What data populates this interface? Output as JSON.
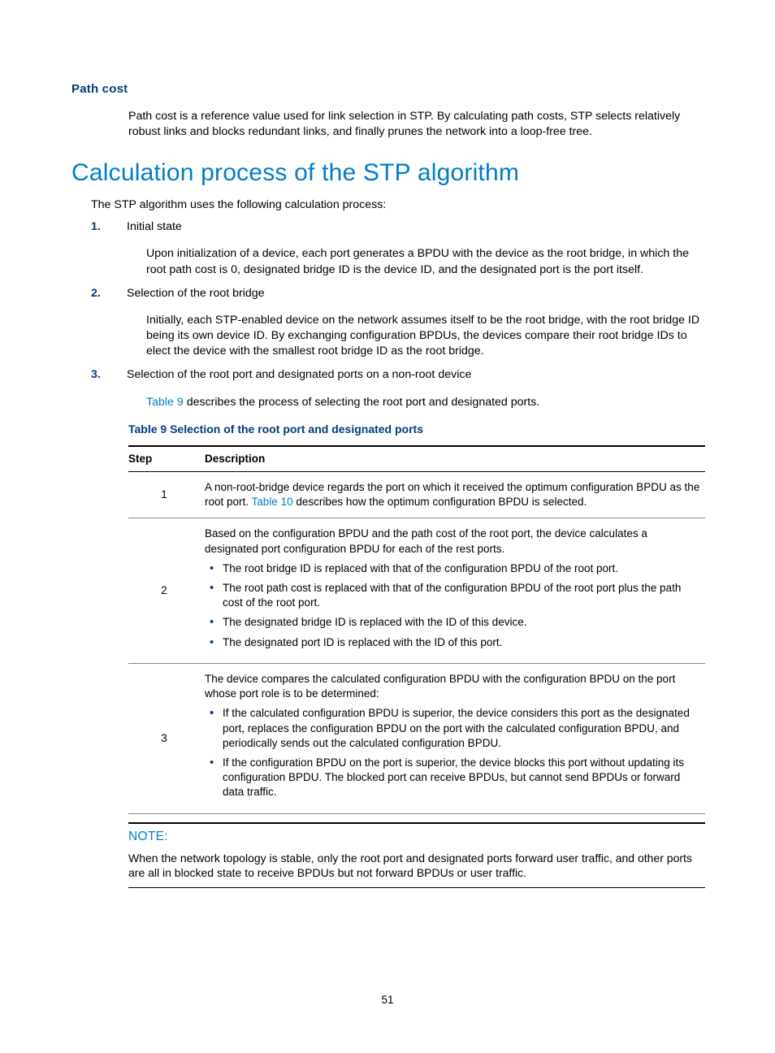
{
  "path_cost": {
    "heading": "Path cost",
    "body": "Path cost is a reference value used for link selection in STP. By calculating path costs, STP selects relatively robust links and blocks redundant links, and finally prunes the network into a loop-free tree."
  },
  "calc": {
    "heading": "Calculation process of the STP algorithm",
    "intro": "The STP algorithm uses the following calculation process:",
    "items": [
      {
        "num": "1.",
        "title": "Initial state",
        "detail": "Upon initialization of a device, each port generates a BPDU with the device as the root bridge, in which the root path cost is 0, designated bridge ID is the device ID, and the designated port is the port itself."
      },
      {
        "num": "2.",
        "title": "Selection of the root bridge",
        "detail": "Initially, each STP-enabled device on the network assumes itself to be the root bridge, with the root bridge ID being its own device ID. By exchanging configuration BPDUs, the devices compare their root bridge IDs to elect the device with the smallest root bridge ID as the root bridge."
      },
      {
        "num": "3.",
        "title": "Selection of the root port and designated ports on a non-root device",
        "detail_link": "Table 9",
        "detail_after": " describes the process of selecting the root port and designated ports."
      }
    ]
  },
  "table9": {
    "caption": "Table 9 Selection of the root port and designated ports",
    "headers": {
      "step": "Step",
      "desc": "Description"
    },
    "rows": [
      {
        "step": "1",
        "lead_before": "A non-root-bridge device regards the port on which it received the optimum configuration BPDU as the root port. ",
        "link": "Table 10",
        "lead_after": " describes how the optimum configuration BPDU is selected."
      },
      {
        "step": "2",
        "lead": "Based on the configuration BPDU and the path cost of the root port, the device calculates a designated port configuration BPDU for each of the rest ports.",
        "bullets": [
          "The root bridge ID is replaced with that of the configuration BPDU of the root port.",
          "The root path cost is replaced with that of the configuration BPDU of the root port plus the path cost of the root port.",
          "The designated bridge ID is replaced with the ID of this device.",
          "The designated port ID is replaced with the ID of this port."
        ]
      },
      {
        "step": "3",
        "lead": "The device compares the calculated configuration BPDU with the configuration BPDU on the port whose port role is to be determined:",
        "bullets": [
          "If the calculated configuration BPDU is superior, the device considers this port as the designated port, replaces the configuration BPDU on the port with the calculated configuration BPDU, and periodically sends out the calculated configuration BPDU.",
          "If the configuration BPDU on the port is superior, the device blocks this port without updating its configuration BPDU. The blocked port can receive BPDUs, but cannot send BPDUs or forward data traffic."
        ]
      }
    ]
  },
  "note": {
    "label": "NOTE:",
    "body": "When the network topology is stable, only the root port and designated ports forward user traffic, and other ports are all in blocked state to receive BPDUs but not forward BPDUs or user traffic."
  },
  "page_number": "51"
}
